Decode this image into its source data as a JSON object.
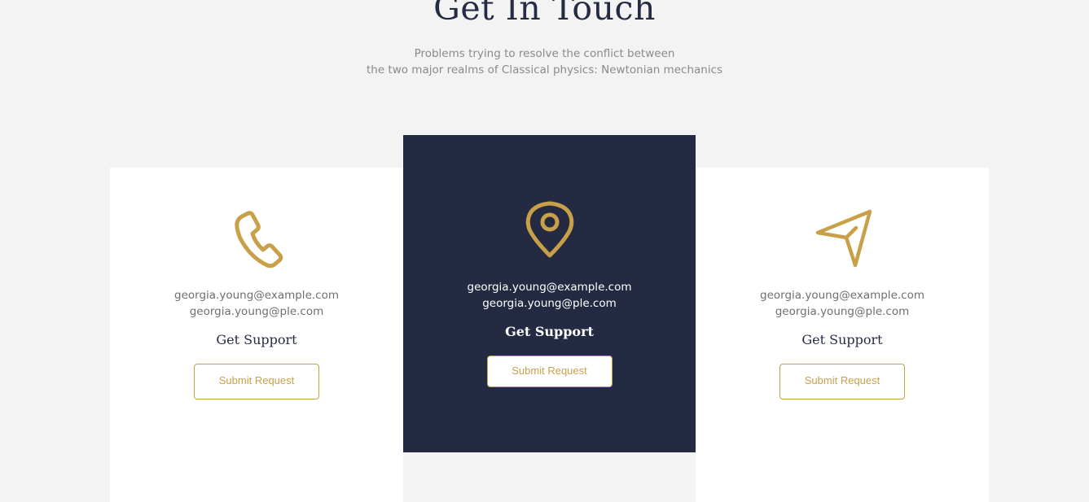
{
  "header": {
    "title": "Get In Touch",
    "subtitle_line1": "Problems trying to resolve the conflict between",
    "subtitle_line2": "the two major realms of Classical physics: Newtonian mechanics"
  },
  "colors": {
    "accent": "#c9a04a",
    "dark_card": "#252a43",
    "heading": "#252b42",
    "background": "#f3f3f3"
  },
  "cards": [
    {
      "icon": "phone-icon",
      "email1": "georgia.young@example.com",
      "email2": "georgia.young@ple.com",
      "title": "Get Support",
      "button": "Submit Request"
    },
    {
      "icon": "location-pin-icon",
      "email1": "georgia.young@example.com",
      "email2": "georgia.young@ple.com",
      "title": "Get Support",
      "button": "Submit Request"
    },
    {
      "icon": "send-icon",
      "email1": "georgia.young@example.com",
      "email2": "georgia.young@ple.com",
      "title": "Get Support",
      "button": "Submit Request"
    }
  ]
}
